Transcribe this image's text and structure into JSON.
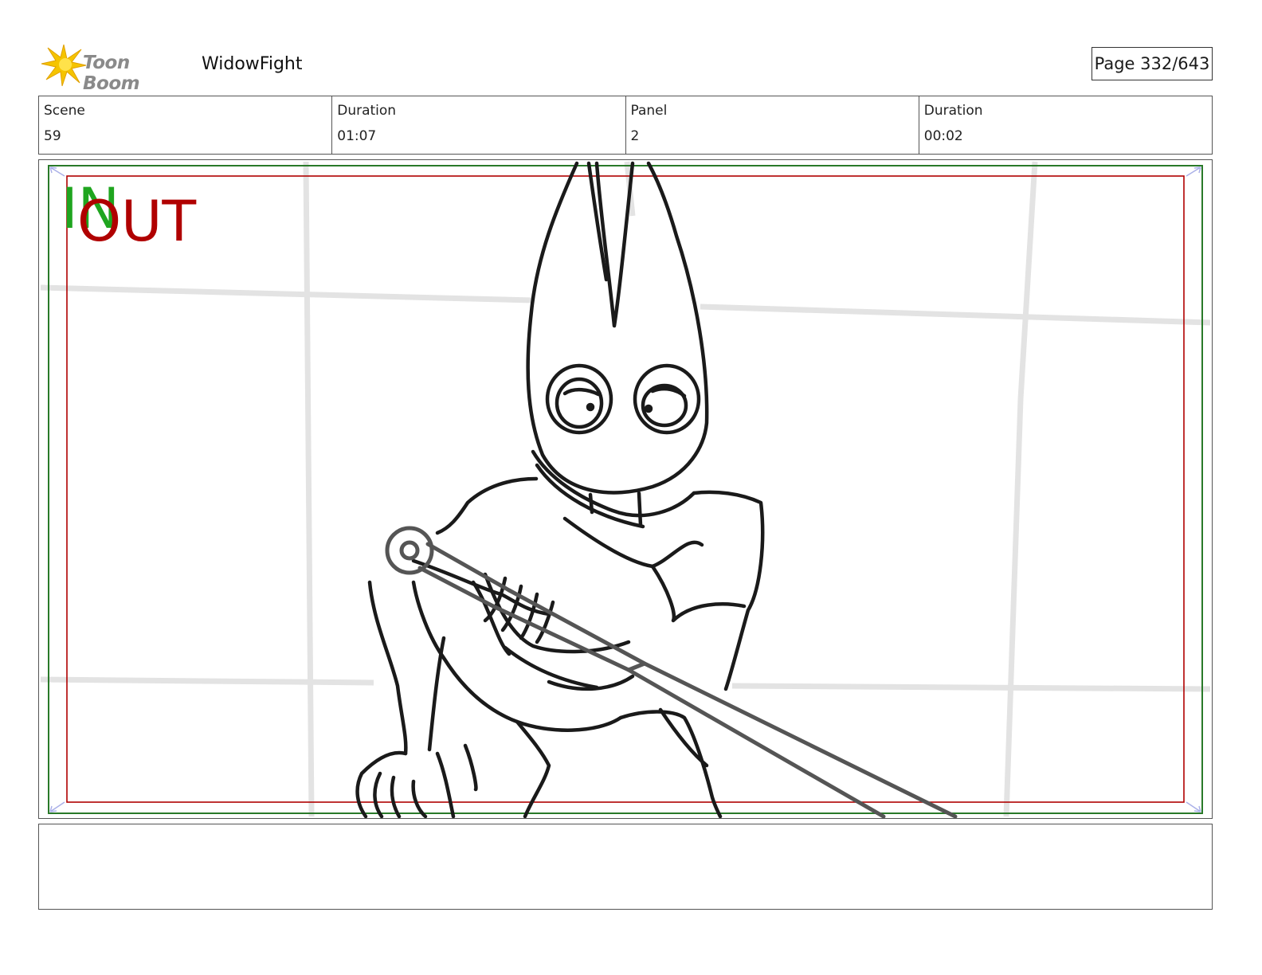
{
  "header": {
    "logo_text": "Toon Boom",
    "project_title": "WidowFight",
    "page_label": "Page 332/643"
  },
  "info": {
    "scene_label": "Scene",
    "scene_value": "59",
    "scene_duration_label": "Duration",
    "scene_duration_value": "01:07",
    "panel_label": "Panel",
    "panel_value": "2",
    "panel_duration_label": "Duration",
    "panel_duration_value": "00:02"
  },
  "panel": {
    "in_marker": "IN",
    "out_marker": "OUT",
    "in_color": "#1fa51f",
    "out_color": "#b00000"
  },
  "notes": {
    "text": ""
  }
}
